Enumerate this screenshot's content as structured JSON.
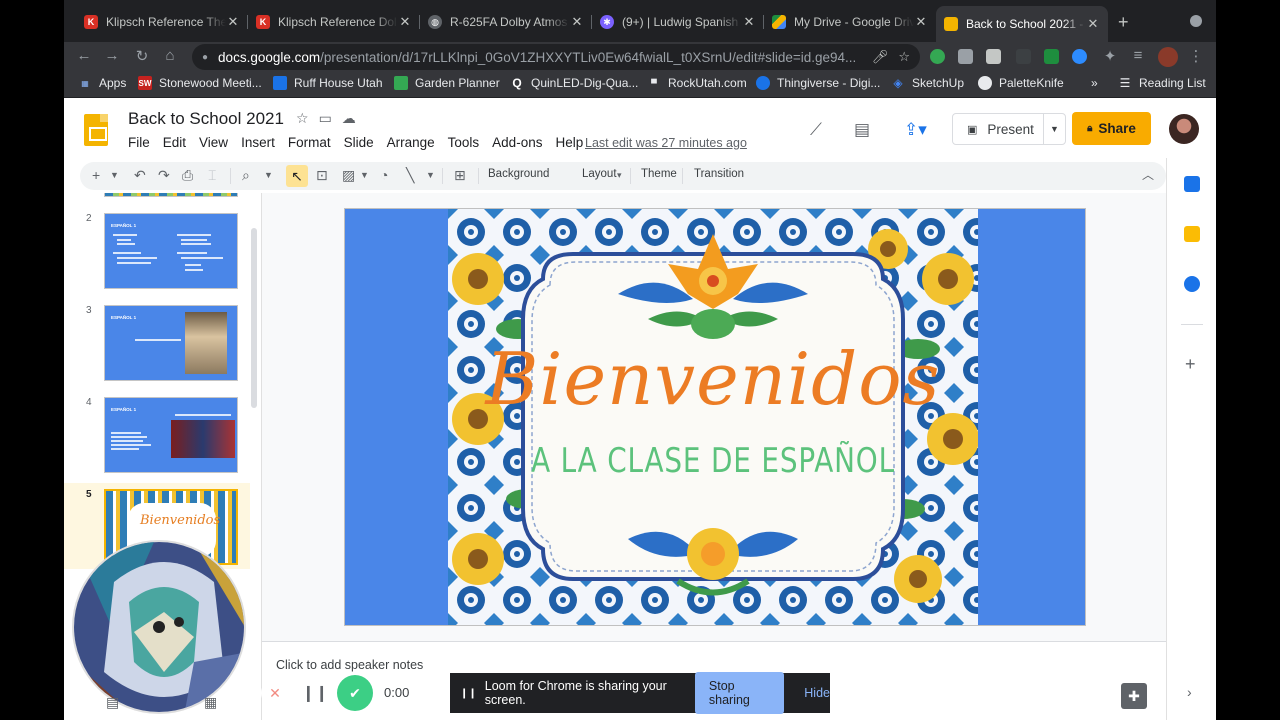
{
  "tabs": [
    {
      "title": "Klipsch Reference The",
      "favicon_color": "#d93025",
      "favicon": "K"
    },
    {
      "title": "Klipsch Reference Dol",
      "favicon_color": "#d93025",
      "favicon": "K"
    },
    {
      "title": "R-625FA Dolby Atmos",
      "favicon_color": "#5f6368",
      "favicon": "globe-icon"
    },
    {
      "title": "(9+) | Ludwig Spanish",
      "favicon_color": "#7b61ff",
      "favicon": "gear-icon"
    },
    {
      "title": "My Drive - Google Driv",
      "favicon_color": "#1e8e3e",
      "favicon": "drive-icon"
    },
    {
      "title": "Back to School 2021 -",
      "favicon_color": "#f4b400",
      "favicon": "slides-icon",
      "active": true
    }
  ],
  "address": {
    "host": "docs.google.com",
    "path": "/presentation/d/17rLLKlnpi_0GoV1ZHXXYTLiv0Ew64fwialL_t0XSrnU/edit#slide=id.ge94..."
  },
  "bookmarks": [
    {
      "label": "Apps",
      "color": "#5f6368",
      "glyph": "▦"
    },
    {
      "label": "Stonewood Meeti...",
      "color": "#c5221f",
      "glyph": "SW"
    },
    {
      "label": "Ruff House Utah",
      "color": "#1a73e8",
      "glyph": "R"
    },
    {
      "label": "Garden Planner",
      "color": "#34a853",
      "glyph": "G"
    },
    {
      "label": "QuinLED-Dig-Qua...",
      "color": "#202124",
      "glyph": "Q"
    },
    {
      "label": "RockUtah.com",
      "color": "#5f6368",
      "glyph": "▀"
    },
    {
      "label": "Thingiverse - Digi...",
      "color": "#1a73e8",
      "glyph": "T"
    },
    {
      "label": "SketchUp",
      "color": "#4285f4",
      "glyph": "S"
    },
    {
      "label": "PaletteKnife",
      "color": "#e8eaed",
      "glyph": "P"
    }
  ],
  "reading_list": "Reading List",
  "doc": {
    "title": "Back to School 2021",
    "menus": [
      "File",
      "Edit",
      "View",
      "Insert",
      "Format",
      "Slide",
      "Arrange",
      "Tools",
      "Add-ons",
      "Help"
    ],
    "last_edit": "Last edit was 27 minutes ago",
    "present_label": "Present",
    "share_label": "Share"
  },
  "toolbar": {
    "background": "Background",
    "layout": "Layout",
    "theme": "Theme",
    "transition": "Transition"
  },
  "filmstrip": [
    {
      "num": "2",
      "title": "ESPAÑOL 1"
    },
    {
      "num": "3",
      "title": "ESPAÑOL 1"
    },
    {
      "num": "4",
      "title": "ESPAÑOL 1"
    },
    {
      "num": "5",
      "title": "",
      "selected": true
    }
  ],
  "slide": {
    "headline": "Bienvenidos",
    "subhead": "A LA CLASE DE ESPAÑOL"
  },
  "notes_placeholder": "Click to add speaker notes",
  "loom": {
    "timer": "0:00",
    "message": "Loom for Chrome is sharing your screen.",
    "stop_label": "Stop sharing",
    "hide_label": "Hide"
  }
}
